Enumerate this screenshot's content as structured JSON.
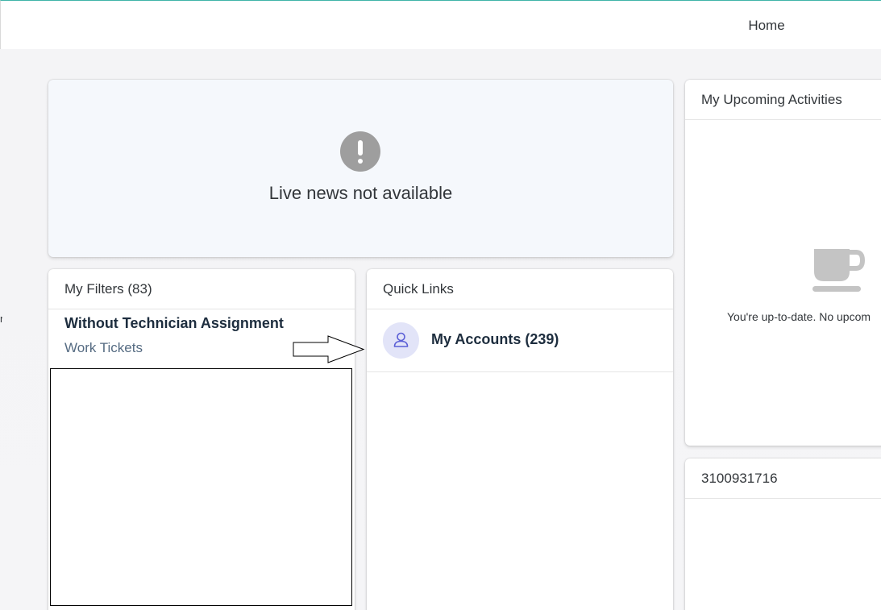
{
  "topbar": {
    "home_label": "Home"
  },
  "edge_text": "n",
  "news": {
    "message": "Live news not available",
    "icon": "exclamation-icon"
  },
  "filters": {
    "title": "My Filters (83)",
    "items": [
      {
        "title": "Without Technician Assignment",
        "subtitle": "Work Tickets"
      }
    ]
  },
  "quick_links": {
    "title": "Quick Links",
    "items": [
      {
        "label": "My Accounts (239)",
        "icon": "person-icon"
      }
    ]
  },
  "activities": {
    "title": "My Upcoming Activities",
    "empty_text": "You're up-to-date. No upcom",
    "icon": "coffee-cup-icon"
  },
  "record_card": {
    "title": "3100931716"
  },
  "colors": {
    "accent": "#3fb4a8",
    "avatar_bg": "#e2e4f8",
    "avatar_icon": "#5b5fd6"
  }
}
